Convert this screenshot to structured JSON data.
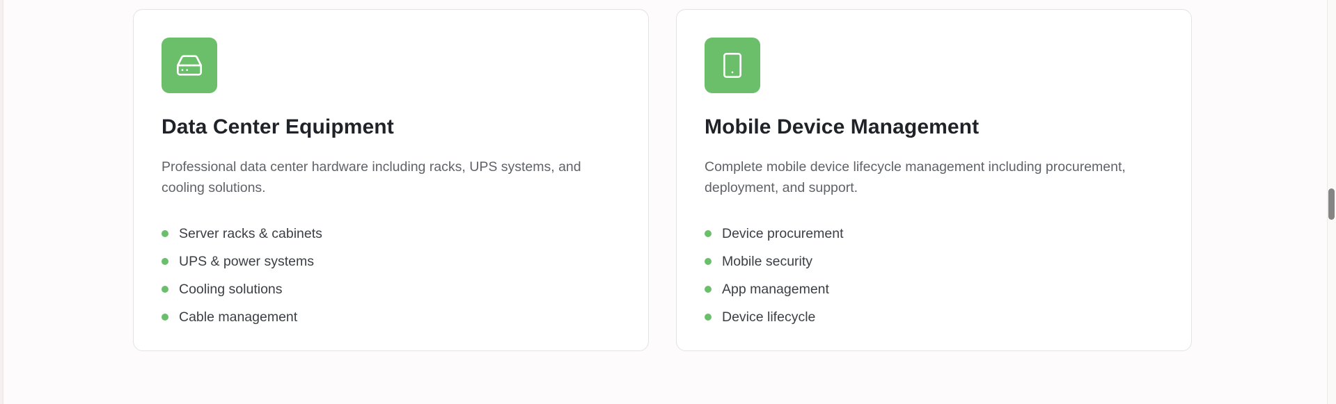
{
  "services": [
    {
      "icon": "hard-drive-icon",
      "title": "Data Center Equipment",
      "description": "Professional data center hardware including racks, UPS systems, and cooling solutions.",
      "features": [
        "Server racks & cabinets",
        "UPS & power systems",
        "Cooling solutions",
        "Cable management"
      ]
    },
    {
      "icon": "tablet-icon",
      "title": "Mobile Device Management",
      "description": "Complete mobile device lifecycle management including procurement, deployment, and support.",
      "features": [
        "Device procurement",
        "Mobile security",
        "App management",
        "Device lifecycle"
      ]
    }
  ],
  "colors": {
    "accent": "#6bbf6a",
    "title": "#1f2328",
    "body": "#5f6368"
  }
}
